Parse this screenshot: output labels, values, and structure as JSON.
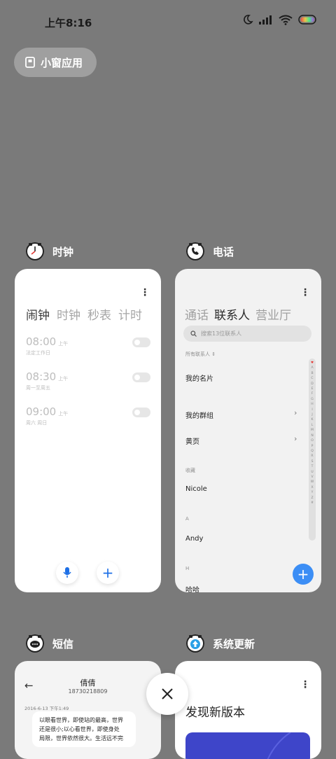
{
  "status_bar": {
    "time": "上午8:16"
  },
  "chip": {
    "label": "小窗应用"
  },
  "apps": {
    "clock": {
      "name": "时钟",
      "tabs": [
        "闹钟",
        "时钟",
        "秒表",
        "计时"
      ],
      "alarms": [
        {
          "time": "08:00",
          "ampm": "上午",
          "repeat": "法定工作日"
        },
        {
          "time": "08:30",
          "ampm": "上午",
          "repeat": "周一至周五"
        },
        {
          "time": "09:00",
          "ampm": "上午",
          "repeat": "周六 周日"
        }
      ],
      "add_label": "+"
    },
    "phone": {
      "name": "电话",
      "tabs": [
        "通话",
        "联系人",
        "营业厅"
      ],
      "search_placeholder": "搜索13位联系人",
      "all_contacts": "所有联系人",
      "my_card": "我的名片",
      "my_groups": "我的群组",
      "yellow_pages": "黄页",
      "favorites_header": "收藏",
      "favorite_contact": "Nicole",
      "section_a": "A",
      "contact_a": "Andy",
      "section_h": "H",
      "contact_h": "哈哈",
      "alphabet": [
        "♥",
        "A",
        "B",
        "C",
        "D",
        "E",
        "F",
        "G",
        "H",
        "I",
        "J",
        "K",
        "L",
        "M",
        "N",
        "O",
        "P",
        "Q",
        "R",
        "S",
        "T",
        "U",
        "V",
        "W",
        "X",
        "Y",
        "Z",
        "#"
      ],
      "fab_label": "+"
    },
    "sms": {
      "name": "短信",
      "contact_name": "倩倩",
      "contact_number": "18730218809",
      "date": "2016-6-13 下午1:49",
      "message_lines": [
        "以眼看世界，即使站的最高，世界",
        "还是很小;以心看世界，即使身处",
        "局限，世界依然很大。生活远不完"
      ]
    },
    "update": {
      "name": "系统更新",
      "title": "发现新版本"
    }
  },
  "colors": {
    "background": "#7a7a7a",
    "accent": "#3c8ef5",
    "mic": "#1d6fe6"
  }
}
